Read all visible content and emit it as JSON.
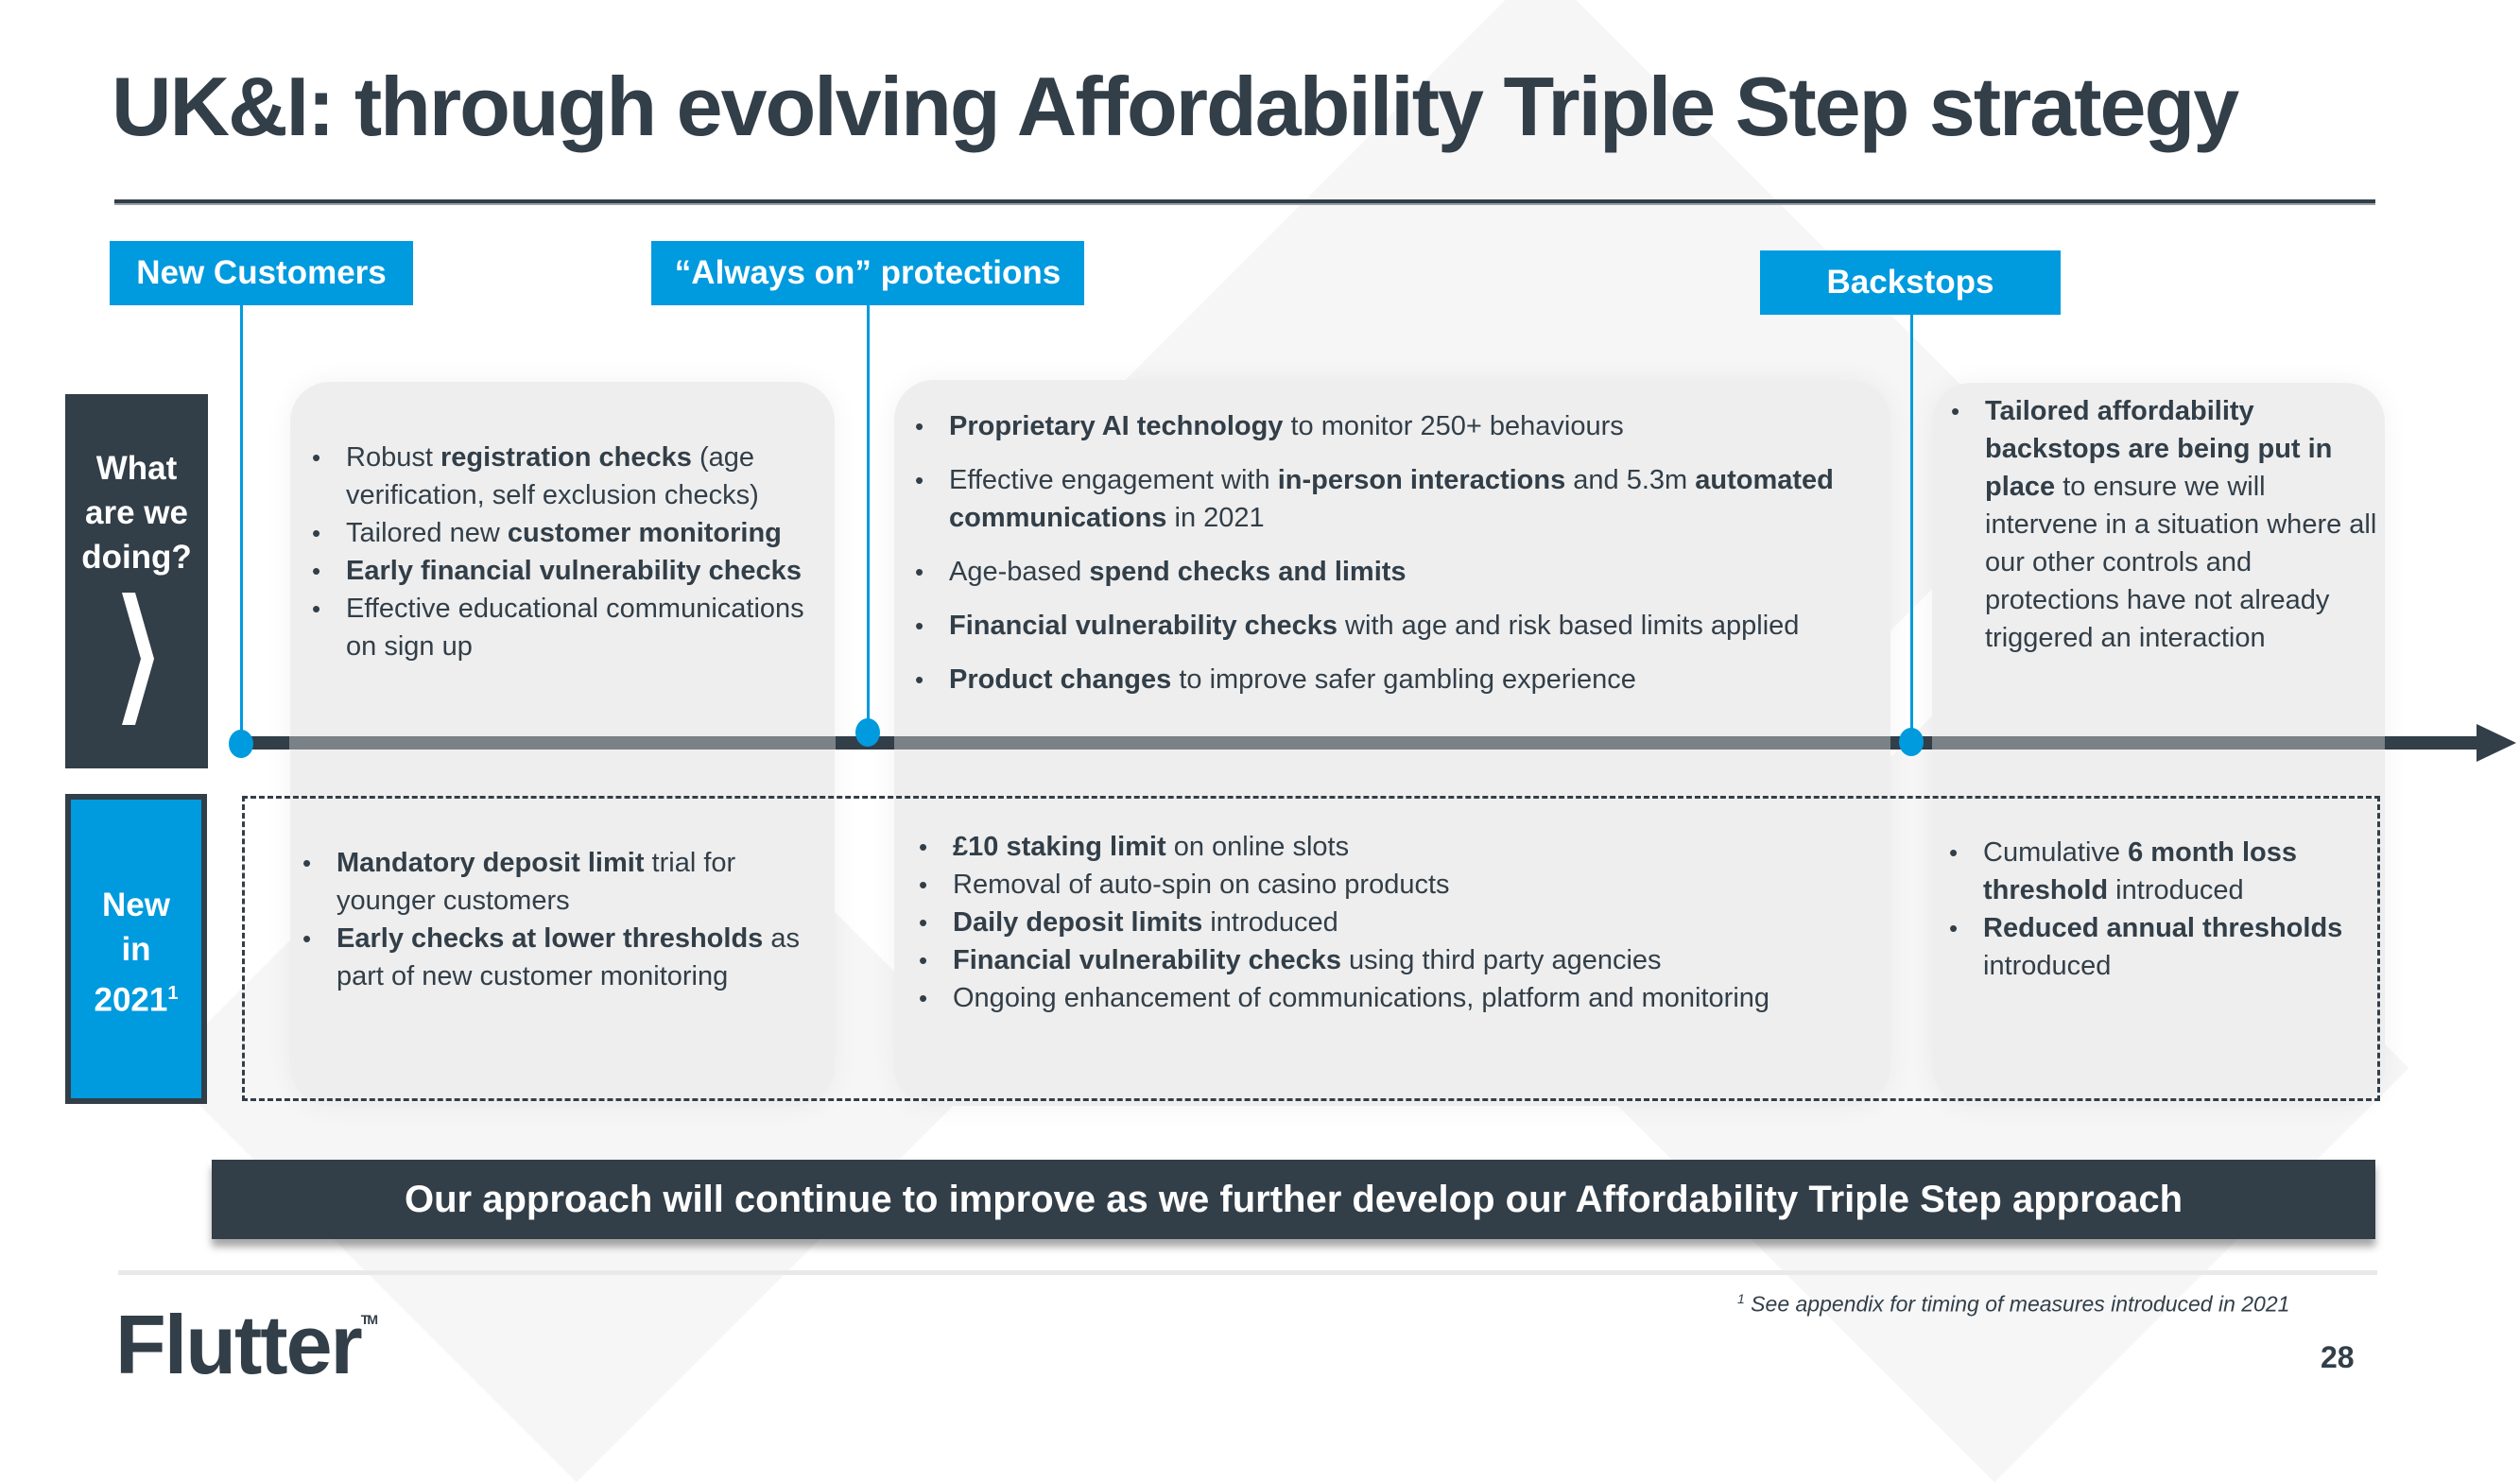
{
  "slide": {
    "title": "UK&I: through evolving Affordability Triple Step strategy",
    "page_number": "28"
  },
  "stages": [
    {
      "label": "New Customers"
    },
    {
      "label": "“Always on” protections"
    },
    {
      "label": "Backstops"
    }
  ],
  "row_labels": {
    "what_line1": "What",
    "what_line2": "are we",
    "what_line3": "doing?",
    "new_line1": "New",
    "new_line2": "in",
    "new_line3": "2021",
    "new_sup": "1"
  },
  "what_we_do": {
    "new_customers": [
      {
        "pre": "Robust ",
        "bold": "registration checks",
        "post": " (age verification, self exclusion checks)"
      },
      {
        "pre": "Tailored new ",
        "bold": "customer monitoring",
        "post": ""
      },
      {
        "pre": "",
        "bold": "Early financial vulnerability checks",
        "post": ""
      },
      {
        "pre": "Effective educational communications on sign up",
        "bold": "",
        "post": ""
      }
    ],
    "always_on": [
      {
        "pre": "",
        "bold": "Proprietary AI technology",
        "post": " to monitor 250+ behaviours"
      },
      {
        "pre": "Effective engagement with ",
        "bold": "in-person interactions",
        "mid": " and 5.3m ",
        "bold2": "automated communications",
        "post": " in 2021"
      },
      {
        "pre": "Age-based ",
        "bold": "spend checks and limits",
        "post": ""
      },
      {
        "pre": "",
        "bold": "Financial vulnerability checks",
        "post": " with age and risk based limits applied"
      },
      {
        "pre": "",
        "bold": "Product changes",
        "post": " to improve safer gambling experience"
      }
    ],
    "backstops": [
      {
        "pre": "",
        "bold": "Tailored affordability backstops are being put in place",
        "post": " to ensure we will intervene in a situation where all our other controls and protections have not already triggered an interaction"
      }
    ]
  },
  "new_in_2021": {
    "new_customers": [
      {
        "pre": "",
        "bold": "Mandatory deposit limit",
        "post": " trial for younger customers"
      },
      {
        "pre": "",
        "bold": "Early checks at lower thresholds",
        "post": " as part of new customer monitoring"
      }
    ],
    "always_on": [
      {
        "pre": "",
        "bold": "£10 staking limit",
        "post": " on online slots"
      },
      {
        "pre": "Removal of auto-spin on casino products",
        "bold": "",
        "post": ""
      },
      {
        "pre": "",
        "bold": "Daily deposit limits",
        "post": " introduced"
      },
      {
        "pre": "",
        "bold": "Financial vulnerability checks",
        "post": " using third party agencies"
      },
      {
        "pre": "Ongoing enhancement of communications, platform and monitoring",
        "bold": "",
        "post": ""
      }
    ],
    "backstops": [
      {
        "pre": "Cumulative ",
        "bold": "6 month loss threshold",
        "post": " introduced"
      },
      {
        "pre": "",
        "bold": "Reduced annual thresholds",
        "post": " introduced"
      }
    ]
  },
  "banner": {
    "text": "Our approach will continue to improve as we further develop our Affordability Triple Step approach"
  },
  "footer": {
    "logo_text": "Flutter",
    "logo_tm": "TM",
    "footnote_sup": "1",
    "footnote_text": " See appendix for timing of measures introduced in 2021"
  },
  "colors": {
    "brand_dark": "#323e48",
    "accent_blue": "#009ade",
    "panel_gray": "#eeeeee",
    "timeline_gray": "#7a8187"
  }
}
